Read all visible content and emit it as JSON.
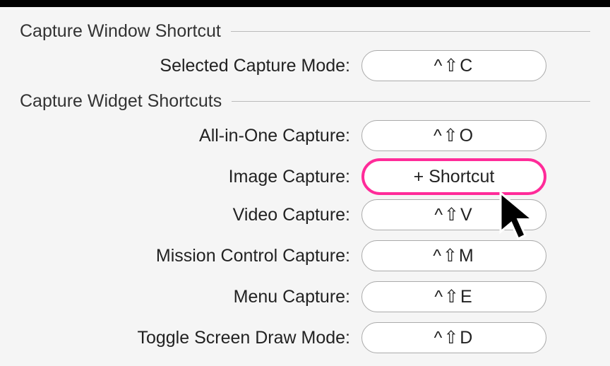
{
  "sections": {
    "captureWindow": {
      "title": "Capture Window Shortcut"
    },
    "captureWidget": {
      "title": "Capture Widget Shortcuts"
    }
  },
  "rows": {
    "selectedMode": {
      "label": "Selected Capture Mode:",
      "value": "^⇧C",
      "highlighted": false
    },
    "allInOne": {
      "label": "All-in-One Capture:",
      "value": "^⇧O",
      "highlighted": false
    },
    "image": {
      "label": "Image Capture:",
      "value": "+ Shortcut",
      "highlighted": true
    },
    "video": {
      "label": "Video Capture:",
      "value": "^⇧V",
      "highlighted": false
    },
    "missionControl": {
      "label": "Mission Control Capture:",
      "value": "^⇧M",
      "highlighted": false
    },
    "menu": {
      "label": "Menu Capture:",
      "value": "^⇧E",
      "highlighted": false
    },
    "toggleDraw": {
      "label": "Toggle Screen Draw Mode:",
      "value": "^⇧D",
      "highlighted": false
    }
  }
}
